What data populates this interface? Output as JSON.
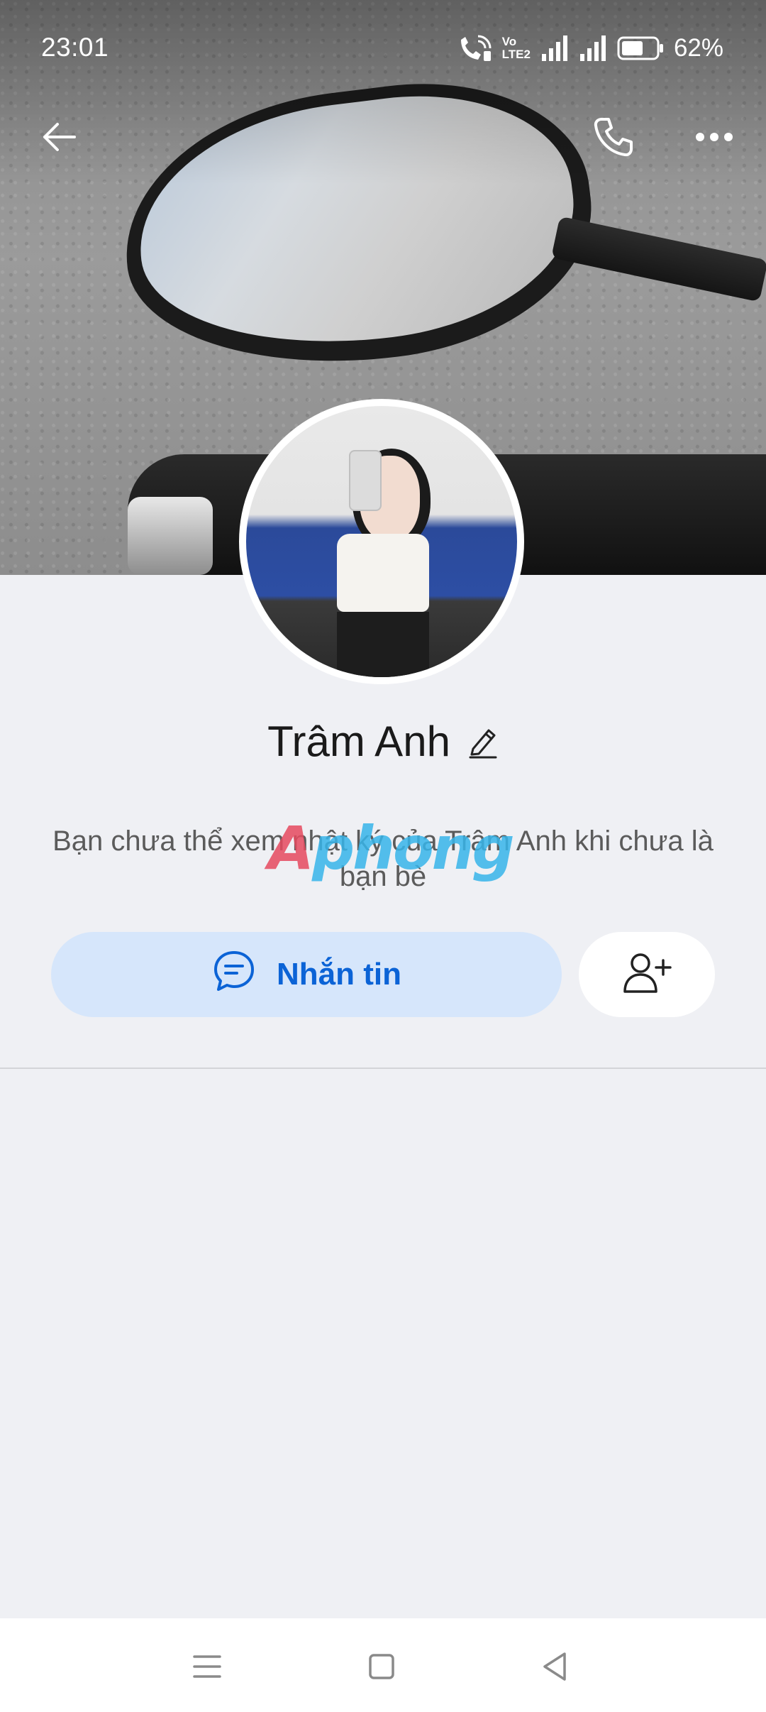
{
  "status_bar": {
    "time": "23:01",
    "battery_percent": "62%",
    "network_label_top": "Vo",
    "network_label_bottom": "LTE2",
    "battery_level": 0.62,
    "icons": [
      "wifi-calling-icon",
      "volte-icon",
      "signal-icon",
      "signal-icon",
      "battery-icon"
    ]
  },
  "top_nav": {
    "back_icon": "arrow-left-icon",
    "call_icon": "phone-icon",
    "more_icon": "more-horizontal-icon"
  },
  "profile": {
    "name": "Trâm Anh",
    "edit_icon": "pencil-icon",
    "info_text": "Bạn chưa thể xem nhật ký của Trâm Anh khi chưa là bạn bè"
  },
  "watermark": {
    "first": "A",
    "rest": "phong"
  },
  "actions": {
    "message_label": "Nhắn tin",
    "message_icon": "chat-bubble-icon",
    "add_friend_icon": "add-friend-icon"
  },
  "colors": {
    "accent": "#0b63d6",
    "message_button_bg": "#d6e6fb",
    "page_bg": "#eff0f4"
  },
  "system_nav": {
    "icons": [
      "menu-icon",
      "home-icon",
      "back-triangle-icon"
    ]
  }
}
